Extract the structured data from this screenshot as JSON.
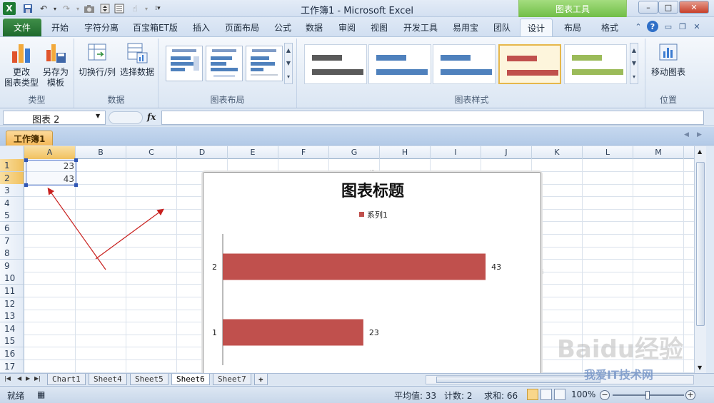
{
  "window": {
    "title": "工作簿1 - Microsoft Excel",
    "context_tab": "图表工具",
    "controls": [
      "–",
      "□",
      "✕"
    ]
  },
  "ribbon_tabs": {
    "file": "文件",
    "tabs": [
      "开始",
      "字符分离",
      "百宝箱ET版",
      "插入",
      "页面布局",
      "公式",
      "数据",
      "审阅",
      "视图",
      "开发工具",
      "易用宝",
      "团队",
      "设计",
      "布局",
      "格式"
    ],
    "active": "设计"
  },
  "ribbon": {
    "type_group": {
      "label": "类型",
      "change_type": "更改\n图表类型",
      "save_template": "另存为\n模板"
    },
    "data_group": {
      "label": "数据",
      "switch_row_col": "切换行/列",
      "select_data": "选择数据"
    },
    "layout_group": {
      "label": "图表布局"
    },
    "styles_group": {
      "label": "图表样式",
      "styles": [
        {
          "color": "#5a5a5a",
          "selected": false
        },
        {
          "color": "#4f81bd",
          "selected": false
        },
        {
          "color": "#4f81bd",
          "selected": false
        },
        {
          "color": "#c0504d",
          "selected": true
        },
        {
          "color": "#9bbb59",
          "selected": false
        }
      ]
    },
    "location_group": {
      "label": "位置",
      "move_chart": "移动图表"
    }
  },
  "formula_bar": {
    "name_box": "图表 2",
    "fx": "fx",
    "value": ""
  },
  "workbook_tab": "工作簿1",
  "grid": {
    "columns": [
      "A",
      "B",
      "C",
      "D",
      "E",
      "F",
      "G",
      "H",
      "I",
      "J",
      "K",
      "L",
      "M"
    ],
    "rows": [
      "1",
      "2",
      "3",
      "4",
      "5",
      "6",
      "7",
      "8",
      "9",
      "10",
      "11",
      "12",
      "13",
      "14",
      "15",
      "16",
      "17"
    ],
    "cells": {
      "A1": "23",
      "A2": "43"
    }
  },
  "chart_data": {
    "type": "bar",
    "orientation": "horizontal",
    "title": "图表标题",
    "legend": "top",
    "categories": [
      "1",
      "2"
    ],
    "series": [
      {
        "name": "系列1",
        "values": [
          23,
          43
        ],
        "color": "#c0504d"
      }
    ],
    "data_labels": true,
    "xlim": [
      0,
      50
    ],
    "grid": false
  },
  "sheet_tabs": {
    "tabs": [
      "Chart1",
      "Sheet4",
      "Sheet5",
      "Sheet6",
      "Sheet7"
    ],
    "active": "Sheet6"
  },
  "status_bar": {
    "mode": "就绪",
    "average": "平均值: 33",
    "count": "计数: 2",
    "sum": "求和: 66",
    "zoom": "100%",
    "zoom_level_percent": 100
  },
  "watermark": {
    "text": "Baidu经验",
    "sub": "我爱IT技术网"
  }
}
